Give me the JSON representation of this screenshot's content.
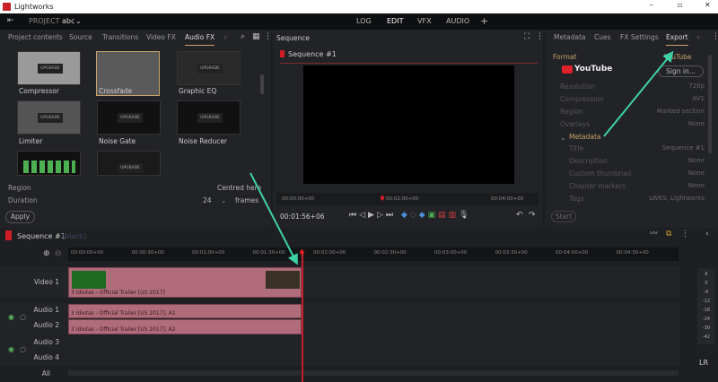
{
  "window": {
    "title": "Lightworks"
  },
  "topbar": {
    "project_label": "PROJECT",
    "project_name": "abc",
    "modes": [
      "LOG",
      "EDIT",
      "VFX",
      "AUDIO"
    ],
    "add": "+",
    "active_mode": "EDIT"
  },
  "left_panel": {
    "tabs": [
      "Project contents",
      "Source",
      "Transitions",
      "Video FX",
      "Audio FX",
      "+"
    ],
    "active_tab": "Audio FX",
    "effects": [
      {
        "label": "Compressor"
      },
      {
        "label": "Crossfade"
      },
      {
        "label": "Graphic EQ"
      },
      {
        "label": "Limiter"
      },
      {
        "label": "Noise Gate"
      },
      {
        "label": "Noise Reducer"
      },
      {
        "label": ""
      },
      {
        "label": ""
      }
    ],
    "upgrade_label": "UPGRADE",
    "region_label": "Region",
    "region_value": "Centred here",
    "duration_label": "Duration",
    "duration_value": "24",
    "duration_unit": "frames",
    "apply": "Apply"
  },
  "viewer": {
    "title": "Sequence",
    "sequence_name": "Sequence #1",
    "timebar": [
      "00:00:00+00",
      "00:02:00+00",
      "00:04:00+00"
    ],
    "timecode": "00:01:56+06"
  },
  "right_panel": {
    "tabs": [
      "Metadata",
      "Cues",
      "FX Settings",
      "Export",
      "+"
    ],
    "active_tab": "Export",
    "format_label": "Format",
    "format_value": "YouTube",
    "brand": "YouTube",
    "sign_in": "Sign in...",
    "fields": [
      {
        "label": "Resolution",
        "value": "720p"
      },
      {
        "label": "Compression",
        "value": "AV1"
      },
      {
        "label": "Region",
        "value": "Marked section"
      },
      {
        "label": "Overlays",
        "value": "None"
      }
    ],
    "metadata_label": "Metadata",
    "metadata_fields": [
      {
        "label": "Title",
        "value": "Sequence #1"
      },
      {
        "label": "Description",
        "value": "None"
      },
      {
        "label": "Custom thumbnail",
        "value": "None"
      },
      {
        "label": "Chapter markers",
        "value": "None"
      },
      {
        "label": "Tags",
        "value": "LWKS, Lightworks"
      }
    ],
    "start": "Start"
  },
  "timeline": {
    "sequence_name": "Sequence #1",
    "sequence_note": "(black)",
    "ruler": [
      "00:00:00+00",
      "00:00:30+00",
      "00:01:00+00",
      "00:01:30+00",
      "00:02:00+00",
      "00:02:30+00",
      "00:03:00+00",
      "00:03:30+00",
      "00:04:00+00",
      "00:04:30+00"
    ],
    "tracks": [
      "Video 1",
      "Audio 1",
      "Audio 2",
      "Audio 3",
      "Audio 4",
      "All"
    ],
    "clips": {
      "video": "3 Idiotas - Official Trailer [US 2017]",
      "a1": "3 Idiotas - Official Trailer [US 2017], A1",
      "a2": "3 Idiotas - Official Trailer [US 2017], A2"
    },
    "meter_scale": [
      "6",
      "0",
      "-6",
      "-12",
      "-18",
      "-24",
      "-30",
      "-42"
    ],
    "meter_label": "LR"
  },
  "colors": {
    "accent": "#c9a46a",
    "clip": "#b06c7a",
    "playhead": "#e0202a",
    "arrow": "#3fd1a6"
  }
}
